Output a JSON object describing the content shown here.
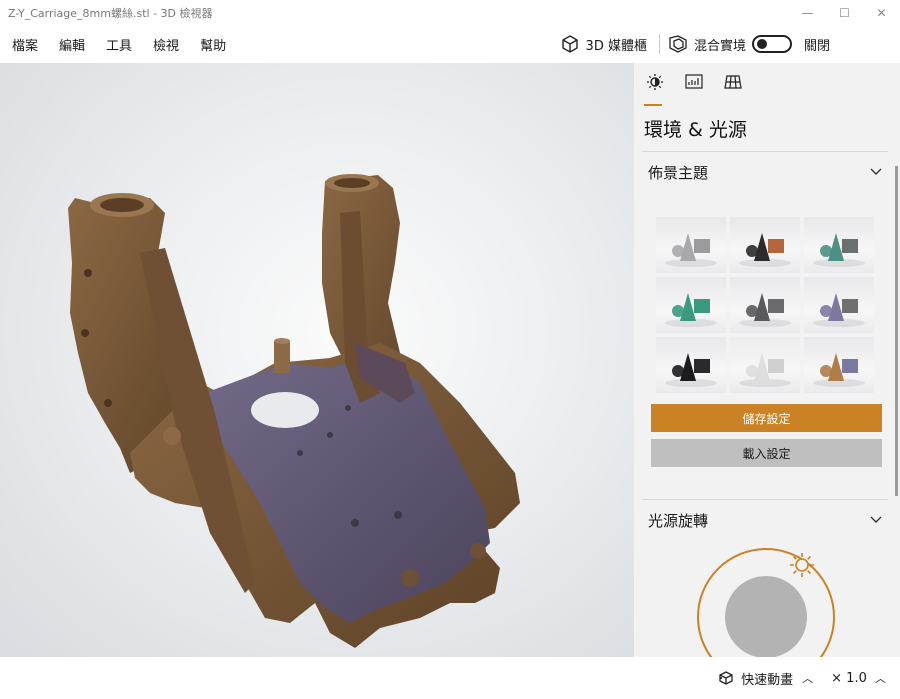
{
  "window": {
    "title": "Z-Y_Carriage_8mm螺絲.stl - 3D 檢視器",
    "minimize": "—",
    "maximize": "☐",
    "close": "✕"
  },
  "menu": {
    "items": [
      "檔案",
      "編輯",
      "工具",
      "檢視",
      "幫助"
    ],
    "library_label": "3D 媒體櫃",
    "mixed_reality_label": "混合實境",
    "toggle_state": "關閉"
  },
  "panel": {
    "tabs": [
      {
        "name": "environment-tab",
        "icon": "sun-icon",
        "active": true
      },
      {
        "name": "stats-tab",
        "icon": "stats-icon",
        "active": false
      },
      {
        "name": "mesh-tab",
        "icon": "grid-icon",
        "active": false
      }
    ],
    "title": "環境 & 光源",
    "theme_section": "佈景主題",
    "themes": [
      {
        "bg": "#e8e8ea",
        "shapes": "#a9a9ab",
        "accent": "#9b9b9d"
      },
      {
        "bg": "#e8e8ea",
        "shapes": "#2d2a2e",
        "accent": "#b5653a"
      },
      {
        "bg": "#e8e8ea",
        "shapes": "#4d8f84",
        "accent": "#6b6f70"
      },
      {
        "bg": "#e8e8ea",
        "shapes": "#3a9a80",
        "accent": "#3a9a80"
      },
      {
        "bg": "#e8e8ea",
        "shapes": "#5a5a5c",
        "accent": "#6b6b6d"
      },
      {
        "bg": "#e8e8ea",
        "shapes": "#7e78a0",
        "accent": "#707070"
      },
      {
        "bg": "#e8e8ea",
        "shapes": "#1c1c1e",
        "accent": "#2a2a2c"
      },
      {
        "bg": "#ececec",
        "shapes": "#dedede",
        "accent": "#d0d0d0"
      },
      {
        "bg": "#e8e8ea",
        "shapes": "#b07c4a",
        "accent": "#7878a0"
      }
    ],
    "save_label": "儲存設定",
    "load_label": "載入設定",
    "light_section": "光源旋轉"
  },
  "status": {
    "animation_label": "快速動畫",
    "speed": "× 1.0"
  },
  "colors": {
    "accent": "#ca8225",
    "model_brown": "#7a5a3a",
    "model_purple": "#5e5570"
  }
}
